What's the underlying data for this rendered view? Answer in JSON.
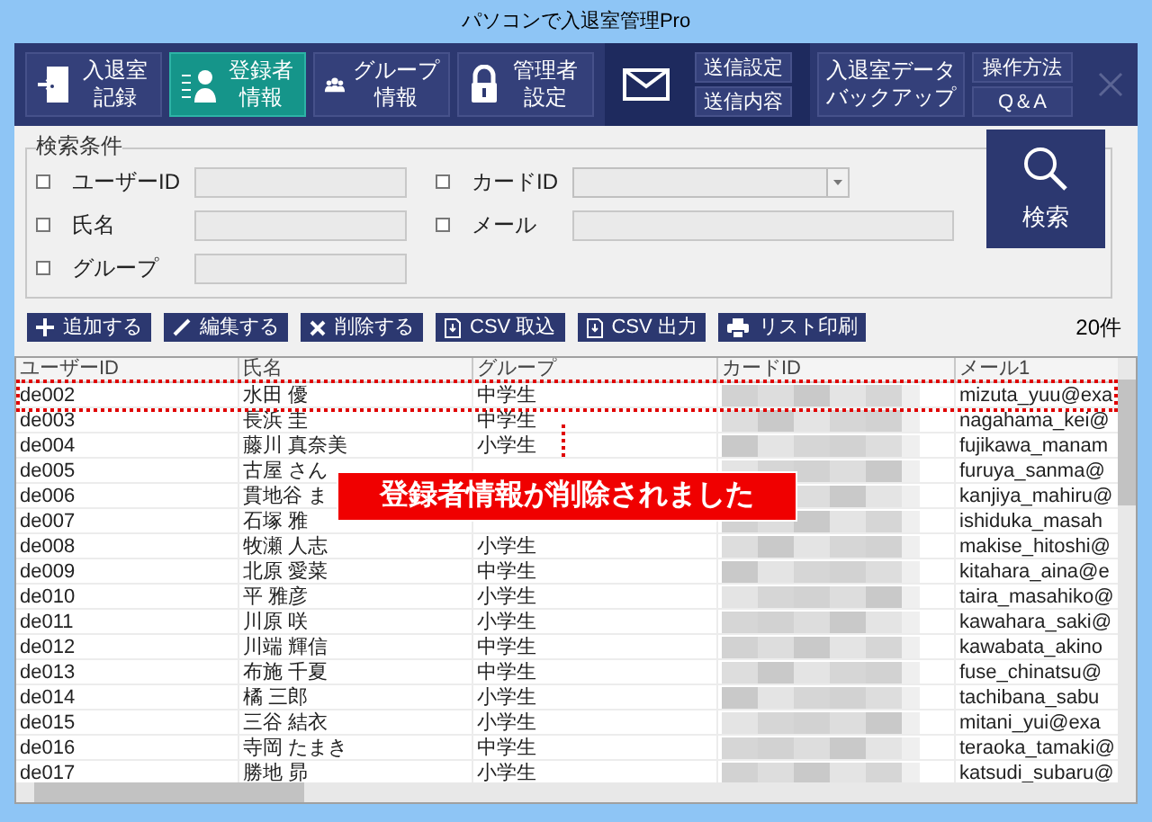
{
  "window": {
    "title": "パソコンで入退室管理Pro"
  },
  "toolbar": {
    "tabs": [
      {
        "kind": "door",
        "label": [
          "入退室",
          "記録"
        ],
        "selected": false
      },
      {
        "kind": "person",
        "label": [
          "登録者",
          "情報"
        ],
        "selected": true
      },
      {
        "kind": "group",
        "label": [
          "グループ",
          "情報"
        ],
        "selected": false
      },
      {
        "kind": "lock",
        "label": [
          "管理者",
          "設定"
        ],
        "selected": false
      }
    ],
    "mail_buttons": [
      "送信設定",
      "送信内容"
    ],
    "backup": [
      "入退室データ",
      "バックアップ"
    ],
    "help_buttons": [
      "操作方法",
      "Q＆A"
    ]
  },
  "search": {
    "legend": "検索条件",
    "fields": [
      {
        "label": "ユーザーID",
        "checked": false,
        "kind": "text"
      },
      {
        "label": "カードID",
        "checked": false,
        "kind": "dropdown"
      },
      {
        "label": "氏名",
        "checked": false,
        "kind": "text"
      },
      {
        "label": "メール",
        "checked": false,
        "kind": "wide"
      },
      {
        "label": "グループ",
        "checked": false,
        "kind": "text"
      }
    ],
    "button": "検索"
  },
  "actions": [
    {
      "kind": "plus",
      "label": "追加する"
    },
    {
      "kind": "pencil",
      "label": "編集する"
    },
    {
      "kind": "cross",
      "label": "削除する"
    },
    {
      "kind": "doc",
      "label": "CSV 取込"
    },
    {
      "kind": "doc",
      "label": "CSV 出力"
    },
    {
      "kind": "printer",
      "label": "リスト印刷"
    }
  ],
  "count": "20件",
  "table": {
    "columns": [
      "ユーザーID",
      "氏名",
      "グループ",
      "カードID",
      "メール1"
    ],
    "rows": [
      {
        "user_id": "de002",
        "name": "水田 優",
        "group": "中学生",
        "email": "mizuta_yuu@exa"
      },
      {
        "user_id": "de003",
        "name": "長浜 圭",
        "group": "中学生",
        "email": "nagahama_kei@"
      },
      {
        "user_id": "de004",
        "name": "藤川 真奈美",
        "group": "小学生",
        "email": "fujikawa_manam"
      },
      {
        "user_id": "de005",
        "name": "古屋 さん",
        "email": "furuya_sanma@"
      },
      {
        "user_id": "de006",
        "name": "貫地谷 ま",
        "email": "kanjiya_mahiru@"
      },
      {
        "user_id": "de007",
        "name": "石塚 雅",
        "email": "ishiduka_masah"
      },
      {
        "user_id": "de008",
        "name": "牧瀬 人志",
        "group": "小学生",
        "email": "makise_hitoshi@"
      },
      {
        "user_id": "de009",
        "name": "北原 愛菜",
        "group": "中学生",
        "email": "kitahara_aina@e"
      },
      {
        "user_id": "de010",
        "name": "平 雅彦",
        "group": "小学生",
        "email": "taira_masahiko@"
      },
      {
        "user_id": "de011",
        "name": "川原 咲",
        "group": "小学生",
        "email": "kawahara_saki@"
      },
      {
        "user_id": "de012",
        "name": "川端 輝信",
        "group": "中学生",
        "email": "kawabata_akino"
      },
      {
        "user_id": "de013",
        "name": "布施 千夏",
        "group": "中学生",
        "email": "fuse_chinatsu@"
      },
      {
        "user_id": "de014",
        "name": "橘 三郎",
        "group": "小学生",
        "email": "tachibana_sabu"
      },
      {
        "user_id": "de015",
        "name": "三谷 結衣",
        "group": "小学生",
        "email": "mitani_yui@exa"
      },
      {
        "user_id": "de016",
        "name": "寺岡 たまき",
        "group": "中学生",
        "email": "teraoka_tamaki@"
      },
      {
        "user_id": "de017",
        "name": "勝地 昴",
        "group": "小学生",
        "email": "katsudi_subaru@"
      }
    ]
  },
  "notice": "登録者情報が削除されました"
}
